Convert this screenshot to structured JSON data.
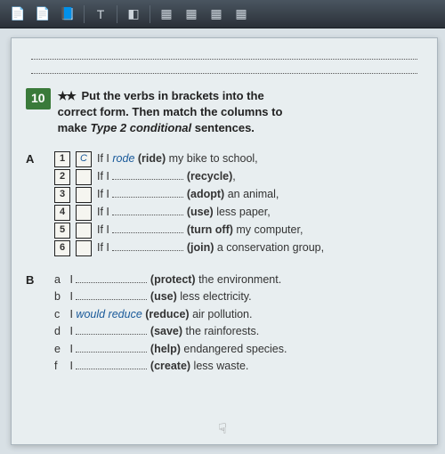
{
  "toolbar": {
    "icons": [
      "page-icon",
      "page-icon",
      "doc-icon",
      "text-icon",
      "stamp-icon",
      "pdf-icon",
      "pdf-icon",
      "pdf-icon",
      "pdf-icon"
    ]
  },
  "exercise": {
    "number": "10",
    "stars": "★★",
    "instruction_line1": "Put the verbs in brackets into the",
    "instruction_line2": "correct form. Then match the columns to",
    "instruction_line3": "make Type 2 conditional sentences."
  },
  "sectionA": {
    "label": "A",
    "items": [
      {
        "n": "1",
        "match": "C",
        "prefix": "If I ",
        "filled": "rode",
        "verb": "(ride)",
        "suffix": " my bike to school,"
      },
      {
        "n": "2",
        "match": "",
        "prefix": "If I ",
        "filled": "",
        "verb": "(recycle)",
        "suffix": ","
      },
      {
        "n": "3",
        "match": "",
        "prefix": "If I ",
        "filled": "",
        "verb": "(adopt)",
        "suffix": " an animal,"
      },
      {
        "n": "4",
        "match": "",
        "prefix": "If I ",
        "filled": "",
        "verb": "(use)",
        "suffix": " less paper,"
      },
      {
        "n": "5",
        "match": "",
        "prefix": "If I ",
        "filled": "",
        "verb": "(turn off)",
        "suffix": " my computer,"
      },
      {
        "n": "6",
        "match": "",
        "prefix": "If I ",
        "filled": "",
        "verb": "(join)",
        "suffix": " a conservation group,"
      }
    ]
  },
  "sectionB": {
    "label": "B",
    "items": [
      {
        "l": "a",
        "prefix": "I ",
        "filled": "",
        "verb": "(protect)",
        "suffix": " the environment."
      },
      {
        "l": "b",
        "prefix": "I ",
        "filled": "",
        "verb": "(use)",
        "suffix": " less electricity."
      },
      {
        "l": "c",
        "prefix": "I ",
        "filled": "would reduce",
        "verb": "(reduce)",
        "suffix": " air pollution."
      },
      {
        "l": "d",
        "prefix": "I ",
        "filled": "",
        "verb": "(save)",
        "suffix": " the rainforests."
      },
      {
        "l": "e",
        "prefix": "I ",
        "filled": "",
        "verb": "(help)",
        "suffix": " endangered species."
      },
      {
        "l": "f",
        "prefix": "I ",
        "filled": "",
        "verb": "(create)",
        "suffix": " less waste."
      }
    ]
  }
}
